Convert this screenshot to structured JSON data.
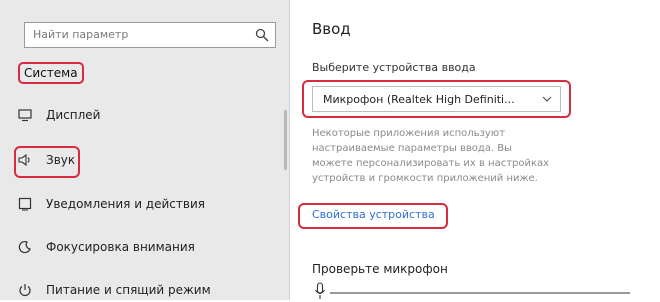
{
  "sidebar": {
    "search_placeholder": "Найти параметр",
    "section": "Система",
    "items": [
      {
        "label": "Дисплей",
        "icon": "display-icon"
      },
      {
        "label": "Звук",
        "icon": "speaker-icon"
      },
      {
        "label": "Уведомления и действия",
        "icon": "notification-icon"
      },
      {
        "label": "Фокусировка внимания",
        "icon": "focus-assist-icon"
      },
      {
        "label": "Питание и спящий режим",
        "icon": "power-icon"
      }
    ]
  },
  "main": {
    "title": "Ввод",
    "device_label": "Выберите устройства ввода",
    "device_value": "Микрофон (Realtek High Definiti...",
    "description": "Некоторые приложения используют настраиваемые параметры ввода. Вы можете персонализировать их в настройках устройств и громкости приложений ниже.",
    "link": "Свойства устройства",
    "test_title": "Проверьте микрофон"
  },
  "colors": {
    "accent": "#3c6fc9",
    "annotation_red": "#d72b3f",
    "sidebar_bg": "#e9e9e9"
  }
}
